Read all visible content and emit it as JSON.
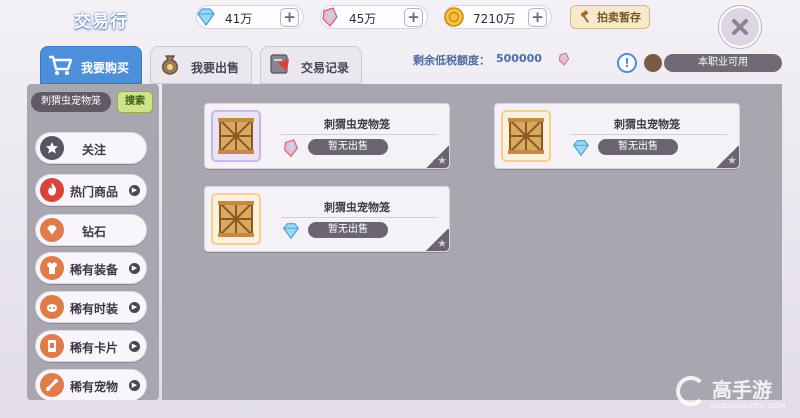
{
  "header": {
    "title": "交易行",
    "currencies": [
      {
        "icon": "diamond-icon",
        "value": "41万",
        "color": "#7fc7ef"
      },
      {
        "icon": "crystal-icon",
        "value": "45万",
        "color": "#e98fa6"
      },
      {
        "icon": "coin-icon",
        "value": "7210万",
        "color": "#f0b429"
      }
    ],
    "auction_storage_label": "拍卖暂存"
  },
  "tabs": [
    {
      "label": "我要购买",
      "icon": "cart-icon",
      "active": true
    },
    {
      "label": "我要出售",
      "icon": "money-bag-icon",
      "active": false
    },
    {
      "label": "交易记录",
      "icon": "scroll-icon",
      "active": false
    }
  ],
  "quota": {
    "label": "剩余低税额度：",
    "value": "500000"
  },
  "job_filter": "本职业可用",
  "search": {
    "text": "刺猬虫宠物笼",
    "button": "搜索"
  },
  "categories": [
    {
      "label": "关注",
      "icon": "star-icon",
      "icon_color": "#4a4652",
      "has_arrow": false
    },
    {
      "label": "热门商品",
      "icon": "hot-icon",
      "icon_color": "#d9433a",
      "has_arrow": true
    },
    {
      "label": "钻石",
      "icon": "diamond-icon",
      "icon_color": "#e07c4a",
      "has_arrow": false
    },
    {
      "label": "稀有装备",
      "icon": "armor-icon",
      "icon_color": "#e07c4a",
      "has_arrow": true
    },
    {
      "label": "稀有时装",
      "icon": "costume-icon",
      "icon_color": "#e07c4a",
      "has_arrow": true
    },
    {
      "label": "稀有卡片",
      "icon": "card-icon",
      "icon_color": "#e07c4a",
      "has_arrow": true
    },
    {
      "label": "稀有宠物",
      "icon": "pet-icon",
      "icon_color": "#e07c4a",
      "has_arrow": true
    }
  ],
  "items": [
    {
      "name": "刺猬虫宠物笼",
      "status": "暂无出售",
      "price_icon": "crystal-icon",
      "frame": "#c9b6e6"
    },
    {
      "name": "刺猬虫宠物笼",
      "status": "暂无出售",
      "price_icon": "diamond-icon",
      "frame": "#f3cf94"
    },
    {
      "name": "刺猬虫宠物笼",
      "status": "暂无出售",
      "price_icon": "diamond-icon",
      "frame": "#f3cf94"
    }
  ],
  "watermark": {
    "text": "高手游",
    "url": "GAOSHOUYOU.COM"
  }
}
